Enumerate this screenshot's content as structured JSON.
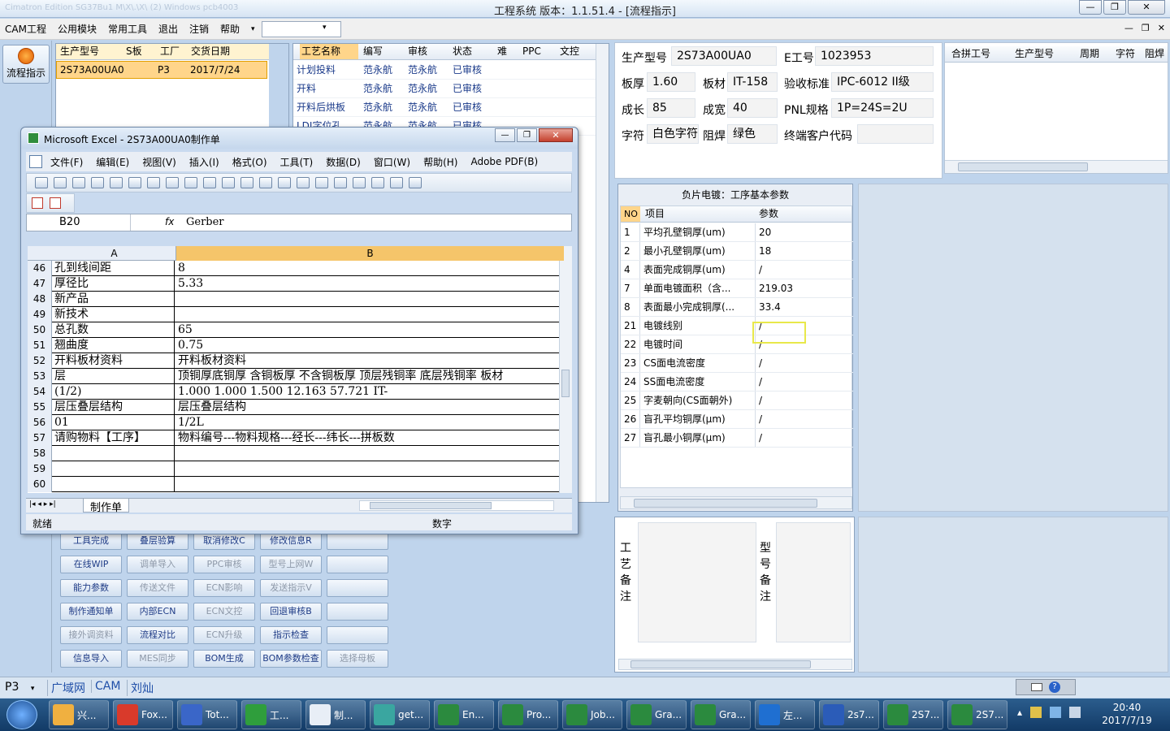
{
  "app": {
    "title": "工程系统   版本：1.1.51.4 - [流程指示]",
    "ghost_text": "Cimatron Edition SG37Bu1 M\\X\\.\\X\\  (2)  Windows  pcb4003"
  },
  "window_controls": {
    "minimize": "—",
    "restore": "❐",
    "close": "✕"
  },
  "menu": {
    "items": [
      "CAM工程",
      "公用模块",
      "常用工具",
      "退出",
      "注销",
      "帮助"
    ],
    "more_arrow": "▾",
    "combo_value": ""
  },
  "mdi_controls": {
    "minimize": "—",
    "restore": "❐",
    "close": "✕"
  },
  "sidebar": {
    "flow_button": "流程指示"
  },
  "orders": {
    "headers": [
      "生产型号",
      "S板",
      "工厂",
      "交货日期"
    ],
    "rows": [
      {
        "model": "2S73A00UA0",
        "s": "",
        "factory": "P3",
        "date": "2017/7/24"
      }
    ]
  },
  "processes": {
    "headers": [
      "工艺名称",
      "编写",
      "审核",
      "状态",
      "难",
      "PPC",
      "文控"
    ],
    "rows": [
      {
        "name": "计划投料",
        "writer": "范永航",
        "reviewer": "范永航",
        "status": "已审核"
      },
      {
        "name": "开料",
        "writer": "范永航",
        "reviewer": "范永航",
        "status": "已审核"
      },
      {
        "name": "开料后烘板",
        "writer": "范永航",
        "reviewer": "范永航",
        "status": "已审核"
      },
      {
        "name": "LDI字位孔",
        "writer": "范永航",
        "reviewer": "范永航",
        "status": "已审核"
      }
    ]
  },
  "action_buttons": [
    [
      {
        "label": "工具完成",
        "enabled": true
      },
      {
        "label": "叠层验算",
        "enabled": true
      },
      {
        "label": "取消修改C",
        "enabled": true
      },
      {
        "label": "修改信息R",
        "enabled": true
      },
      {
        "label": "",
        "enabled": true
      }
    ],
    [
      {
        "label": "在线WIP",
        "enabled": true
      },
      {
        "label": "调单导入",
        "enabled": false
      },
      {
        "label": "PPC审核",
        "enabled": false
      },
      {
        "label": "型号上网W",
        "enabled": false
      },
      {
        "label": "",
        "enabled": true
      }
    ],
    [
      {
        "label": "能力参数",
        "enabled": true
      },
      {
        "label": "传送文件",
        "enabled": false
      },
      {
        "label": "ECN影响",
        "enabled": false
      },
      {
        "label": "发送指示V",
        "enabled": false
      },
      {
        "label": "",
        "enabled": true
      }
    ],
    [
      {
        "label": "制作通知单",
        "enabled": true
      },
      {
        "label": "内部ECN",
        "enabled": true
      },
      {
        "label": "ECN文控",
        "enabled": false
      },
      {
        "label": "回退审核B",
        "enabled": true
      },
      {
        "label": "",
        "enabled": true
      }
    ],
    [
      {
        "label": "接外调资料",
        "enabled": false
      },
      {
        "label": "流程对比",
        "enabled": true
      },
      {
        "label": "ECN升级",
        "enabled": false
      },
      {
        "label": "指示检查",
        "enabled": true
      },
      {
        "label": "",
        "enabled": true
      }
    ],
    [
      {
        "label": "信息导入",
        "enabled": true
      },
      {
        "label": "MES同步",
        "enabled": false
      },
      {
        "label": "BOM生成",
        "enabled": true
      },
      {
        "label": "BOM参数检查",
        "enabled": true
      },
      {
        "label": "选择母板",
        "enabled": false
      }
    ]
  ],
  "info": {
    "fields": [
      {
        "label": "生产型号",
        "value": "2S73A00UA0"
      },
      {
        "label": "E工号",
        "value": "1023953"
      },
      {
        "label": "板厚",
        "value": "1.60"
      },
      {
        "label": "板材",
        "value": "IT-158"
      },
      {
        "label": "验收标准",
        "value": "IPC-6012 II级"
      },
      {
        "label": "成长",
        "value": "85"
      },
      {
        "label": "成宽",
        "value": "40"
      },
      {
        "label": "PNL规格",
        "value": "1P=24S=2U"
      },
      {
        "label": "字符",
        "value": "白色字符"
      },
      {
        "label": "阻焊",
        "value": "绿色"
      },
      {
        "label": "终端客户代码",
        "value": ""
      }
    ]
  },
  "merge_grid": {
    "headers": [
      "合拼工号",
      "生产型号",
      "周期",
      "字符",
      "阻焊"
    ]
  },
  "params": {
    "title": "负片电镀：工序基本参数",
    "headers": [
      "NO",
      "项目",
      "参数"
    ],
    "rows": [
      {
        "no": "1",
        "item": "平均孔壁铜厚(um)",
        "value": "20"
      },
      {
        "no": "2",
        "item": "最小孔壁铜厚(um)",
        "value": "18"
      },
      {
        "no": "4",
        "item": "表面完成铜厚(um)",
        "value": "/"
      },
      {
        "no": "7",
        "item": "单面电镀面积（含...",
        "value": "219.03"
      },
      {
        "no": "8",
        "item": "表面最小完成铜厚(...",
        "value": "33.4"
      },
      {
        "no": "21",
        "item": "电镀线别",
        "value": "/"
      },
      {
        "no": "22",
        "item": "电镀时间",
        "value": "/"
      },
      {
        "no": "23",
        "item": "CS面电流密度",
        "value": "/"
      },
      {
        "no": "24",
        "item": "SS面电流密度",
        "value": "/"
      },
      {
        "no": "25",
        "item": "字麦朝向(CS面朝外)",
        "value": "/"
      },
      {
        "no": "26",
        "item": "盲孔平均铜厚(μm)",
        "value": "/"
      },
      {
        "no": "27",
        "item": "盲孔最小铜厚(μm)",
        "value": "/"
      }
    ]
  },
  "notes": {
    "process_label": "工艺备注",
    "model_label": "型号备注"
  },
  "excel": {
    "title": "Microsoft Excel - 2S73A00UA0制作单",
    "menu": [
      "文件(F)",
      "编辑(E)",
      "视图(V)",
      "插入(I)",
      "格式(O)",
      "工具(T)",
      "数据(D)",
      "窗口(W)",
      "帮助(H)",
      "Adobe PDF(B)"
    ],
    "name_box": "B20",
    "fx": "fx",
    "formula": "Gerber",
    "col_a": "A",
    "col_b": "B",
    "rows": [
      {
        "n": "46",
        "a": "孔到线间距",
        "b": "8"
      },
      {
        "n": "47",
        "a": "厚径比",
        "b": "5.33"
      },
      {
        "n": "48",
        "a": "新产品",
        "b": ""
      },
      {
        "n": "49",
        "a": "新技术",
        "b": ""
      },
      {
        "n": "50",
        "a": "总孔数",
        "b": "65"
      },
      {
        "n": "51",
        "a": "翘曲度",
        "b": "0.75"
      },
      {
        "n": "52",
        "a": "开料板材资料",
        "b": "开料板材资料"
      },
      {
        "n": "53",
        "a": "层",
        "b": "顶铜厚底铜厚 含铜板厚 不含铜板厚 顶层残铜率 底层残铜率 板材"
      },
      {
        "n": "54",
        "a": "(1/2)",
        "b": "1.000  1.000   1.500          12.163     57.721     IT-"
      },
      {
        "n": "55",
        "a": "层压叠层结构",
        "b": "层压叠层结构"
      },
      {
        "n": "56",
        "a": "01",
        "b": "1/2L"
      },
      {
        "n": "57",
        "a": "请购物料【工序】",
        "b": "物料编号---物料规格---经长---纬长---拼板数"
      },
      {
        "n": "58",
        "a": "",
        "b": ""
      },
      {
        "n": "59",
        "a": "",
        "b": ""
      },
      {
        "n": "60",
        "a": "",
        "b": ""
      }
    ],
    "sheet_tab": "制作单",
    "status_left": "就绪",
    "status_mode": "数字"
  },
  "statusbar": {
    "factory": "P3",
    "items": [
      "广域网",
      "CAM",
      "刘灿"
    ]
  },
  "taskbar": {
    "items": [
      {
        "label": "兴...",
        "color": "#f0b040"
      },
      {
        "label": "Fox...",
        "color": "#d93a2b"
      },
      {
        "label": "Tot...",
        "color": "#3a66c8"
      },
      {
        "label": "工...",
        "color": "#2f9e3c"
      },
      {
        "label": "制...",
        "color": "#e8eef6"
      },
      {
        "label": "get...",
        "color": "#3aa6a0"
      },
      {
        "label": "En...",
        "color": "#2b8a3e"
      },
      {
        "label": "Pro...",
        "color": "#2b8a3e"
      },
      {
        "label": "Job...",
        "color": "#2b8a3e"
      },
      {
        "label": "Gra...",
        "color": "#2b8a3e"
      },
      {
        "label": "Gra...",
        "color": "#2b8a3e"
      },
      {
        "label": "左...",
        "color": "#1f6fd1"
      },
      {
        "label": "2s7...",
        "color": "#2b5cb8"
      },
      {
        "label": "2S7...",
        "color": "#2b8a3e"
      },
      {
        "label": "2S7...",
        "color": "#2b8a3e"
      }
    ],
    "time": "20:40",
    "date": "2017/7/19"
  }
}
